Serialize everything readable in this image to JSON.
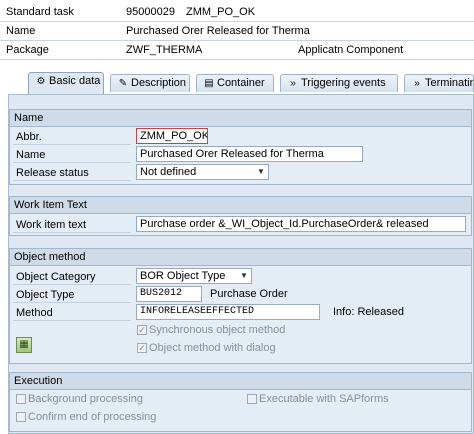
{
  "header": {
    "standard_task_label": "Standard task",
    "standard_task_id": "95000029",
    "standard_task_abbr": "ZMM_PO_OK",
    "name_label": "Name",
    "name_value": "Purchased Orer Released for Therma",
    "package_label": "Package",
    "package_value": "ZWF_THERMA",
    "app_component_label": "Applicatn Component"
  },
  "tabs": [
    {
      "label": "Basic data",
      "icon": "wrench-icon"
    },
    {
      "label": "Description",
      "icon": "pencil-icon"
    },
    {
      "label": "Container",
      "icon": "container-icon"
    },
    {
      "label": "Triggering events",
      "icon": "event-icon"
    },
    {
      "label": "Terminating",
      "icon": "event-icon"
    }
  ],
  "name_group": {
    "title": "Name",
    "abbr_label": "Abbr.",
    "abbr_value": "ZMM_PO_OK",
    "name_label": "Name",
    "name_value": "Purchased Orer Released for Therma",
    "release_label": "Release status",
    "release_value": "Not defined"
  },
  "work_item_group": {
    "title": "Work Item Text",
    "label": "Work item text",
    "value": "Purchase order &_WI_Object_Id.PurchaseOrder& released"
  },
  "object_method_group": {
    "title": "Object method",
    "category_label": "Object Category",
    "category_value": "BOR Object Type",
    "type_label": "Object Type",
    "type_value": "BUS2012",
    "type_desc": "Purchase Order",
    "method_label": "Method",
    "method_value": "INFORELEASEEFFECTED",
    "method_info": "Info: Released",
    "sync_label": "Synchronous object method",
    "dialog_label": "Object method with dialog"
  },
  "execution_group": {
    "title": "Execution",
    "background_label": "Background processing",
    "sapforms_label": "Executable with SAPforms",
    "confirm_label": "Confirm end of processing"
  },
  "colors": {
    "panel_bg": "#dfe8f2",
    "group_title_bg": "#cfdbe9",
    "selection_border": "#d04040"
  }
}
